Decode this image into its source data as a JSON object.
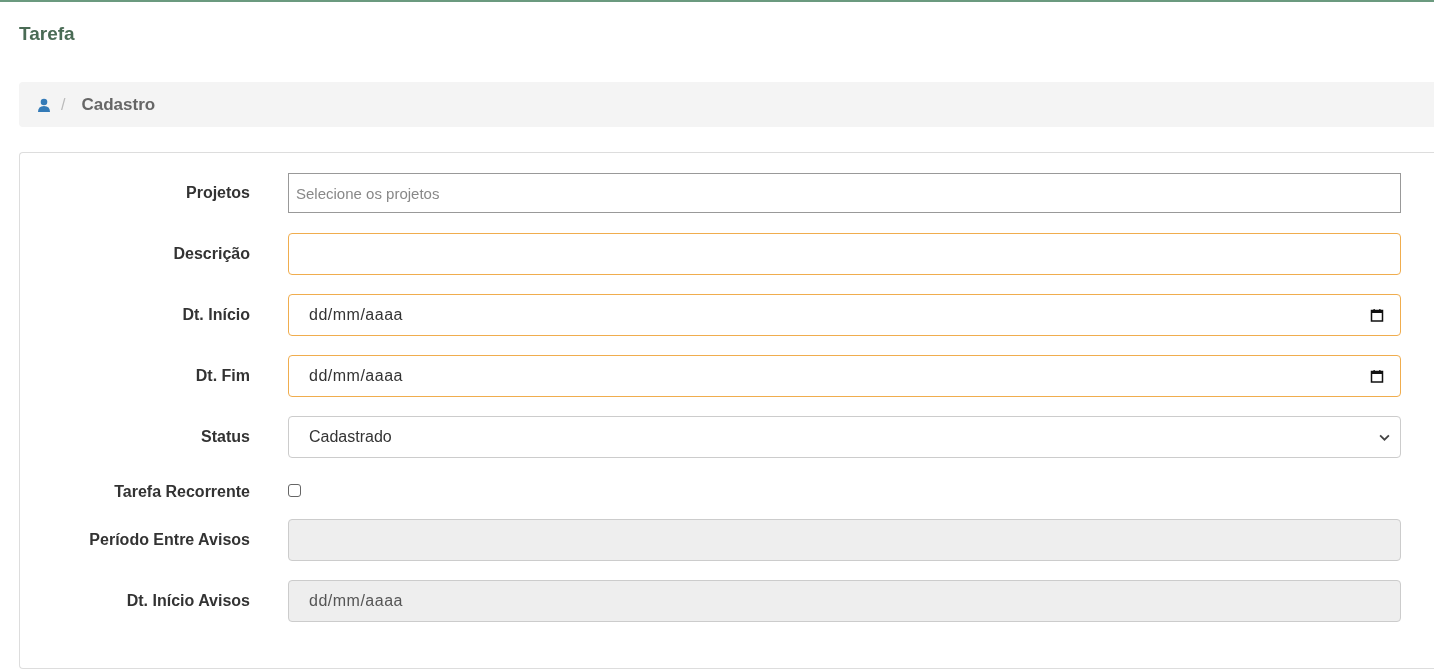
{
  "page_title": "Tarefa",
  "breadcrumb": {
    "separator": "/",
    "current": "Cadastro"
  },
  "form": {
    "fields": [
      {
        "kind": "multiselect",
        "label": "Projetos",
        "placeholder": "Selecione os projetos"
      },
      {
        "kind": "text",
        "label": "Descrição",
        "highlighted": true,
        "disabled": false
      },
      {
        "kind": "date",
        "label": "Dt. Início",
        "placeholder": "dd/mm/aaaa",
        "highlighted": true,
        "disabled": false
      },
      {
        "kind": "date",
        "label": "Dt. Fim",
        "placeholder": "dd/mm/aaaa",
        "highlighted": true,
        "disabled": false
      },
      {
        "kind": "select",
        "label": "Status",
        "value": "Cadastrado"
      },
      {
        "kind": "checkbox",
        "label": "Tarefa Recorrente",
        "checked": false
      },
      {
        "kind": "text",
        "label": "Período Entre Avisos",
        "highlighted": false,
        "disabled": true
      },
      {
        "kind": "date",
        "label": "Dt. Início Avisos",
        "placeholder": "dd/mm/aaaa",
        "highlighted": false,
        "disabled": true
      }
    ]
  }
}
